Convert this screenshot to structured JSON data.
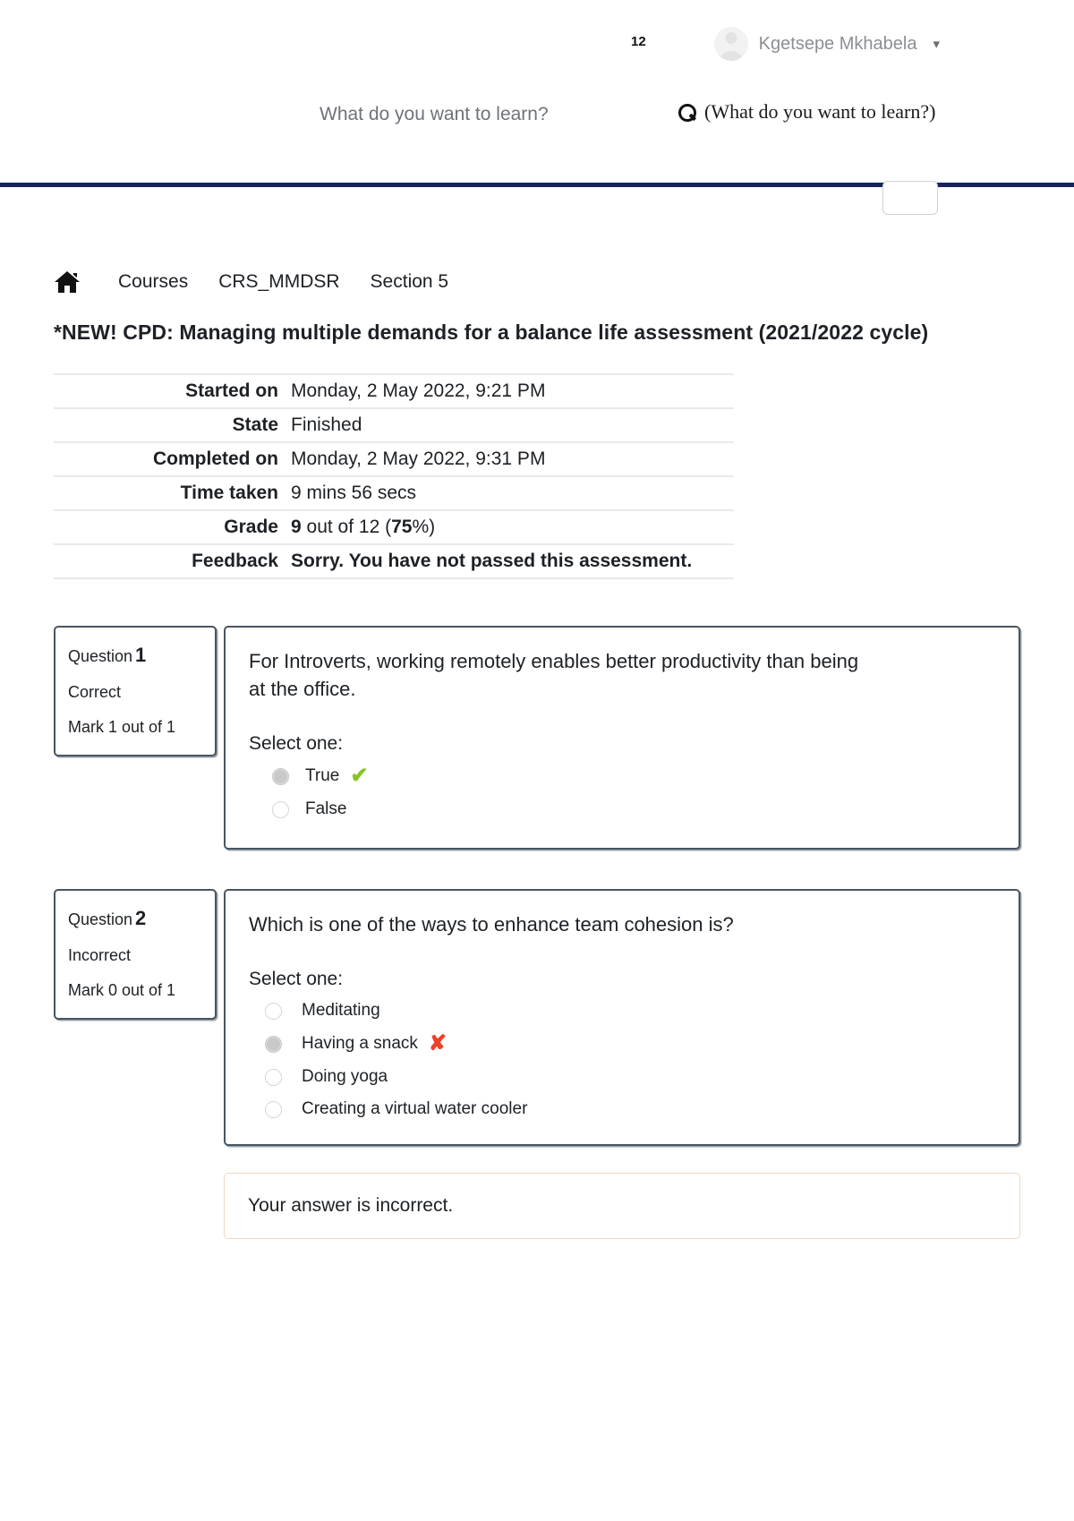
{
  "topbar": {
    "page_counter": "12",
    "user_name": "Kgetsepe Mkhabela",
    "caret_icon": "chevron-down-icon",
    "avatar_icon": "user-avatar-icon"
  },
  "search": {
    "placeholder": "What do you want to learn?",
    "value": "",
    "submit_label": "(What do you want to learn?)",
    "icon": "search-icon"
  },
  "breadcrumb": {
    "home_icon": "home-icon",
    "items": [
      {
        "label": "Courses"
      },
      {
        "label": "CRS_MMDSR"
      },
      {
        "label": "Section 5"
      }
    ]
  },
  "page": {
    "title": "*NEW! CPD: Managing multiple demands for a balance life assessment (2021/2022 cycle)"
  },
  "summary": {
    "rows": [
      {
        "label": "Started on",
        "value": "Monday, 2 May 2022, 9:21 PM"
      },
      {
        "label": "State",
        "value": "Finished"
      },
      {
        "label": "Completed on",
        "value": "Monday, 2 May 2022, 9:31 PM"
      },
      {
        "label": "Time taken",
        "value": "9 mins 56 secs"
      }
    ],
    "grade": {
      "label": "Grade",
      "score": "9",
      "middle": " out of 12 (",
      "percent": "75",
      "tail": "%)"
    },
    "feedback": {
      "label": "Feedback",
      "value": "Sorry. You have not passed this assessment."
    }
  },
  "questions": [
    {
      "number_label": "Question",
      "number": "1",
      "state": "Correct",
      "mark": "Mark 1 out of 1",
      "text": "For Introverts, working remotely enables better productivity than being at the office.",
      "select_one": "Select one:",
      "answers": [
        {
          "label": "True",
          "selected": true,
          "mark": "✔",
          "mark_type": "correct"
        },
        {
          "label": "False",
          "selected": false,
          "mark": "",
          "mark_type": ""
        }
      ]
    },
    {
      "number_label": "Question",
      "number": "2",
      "state": "Incorrect",
      "mark": "Mark 0 out of 1",
      "text": "Which is one of the ways to enhance team cohesion is?",
      "select_one": "Select one:",
      "answers": [
        {
          "label": "Meditating",
          "selected": false,
          "mark": "",
          "mark_type": ""
        },
        {
          "label": "Having a snack",
          "selected": true,
          "mark": "✘",
          "mark_type": "wrong"
        },
        {
          "label": "Doing yoga",
          "selected": false,
          "mark": "",
          "mark_type": ""
        },
        {
          "label": "Creating a virtual water cooler",
          "selected": false,
          "mark": "",
          "mark_type": ""
        }
      ]
    }
  ],
  "answer_feedback": {
    "text": "Your answer is incorrect."
  },
  "colors": {
    "navy_rule": "#16265c",
    "correct_green": "#88c425",
    "wrong_red": "#f0402a",
    "feedback_border": "#f0d9c0"
  }
}
